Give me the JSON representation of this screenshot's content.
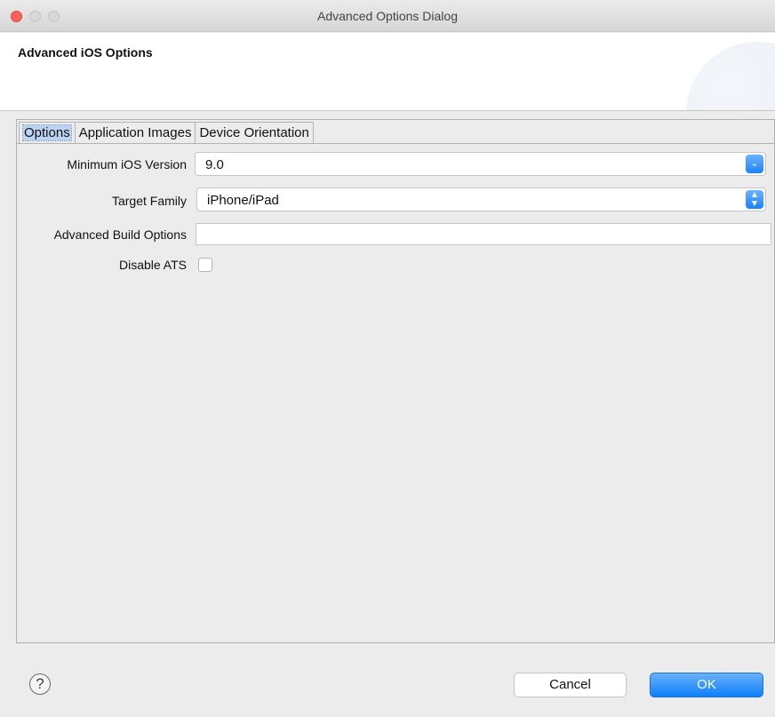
{
  "window": {
    "title": "Advanced Options Dialog"
  },
  "header": {
    "title": "Advanced iOS Options"
  },
  "tabs": [
    {
      "label": "Options",
      "active": true
    },
    {
      "label": "Application Images",
      "active": false
    },
    {
      "label": "Device Orientation",
      "active": false
    }
  ],
  "options": {
    "min_ios_version": {
      "label": "Minimum iOS Version",
      "value": "9.0",
      "control_icon": "chevron-down-icon"
    },
    "target_family": {
      "label": "Target Family",
      "value": "iPhone/iPad",
      "control_icon": "up-down-chevron-icon"
    },
    "advanced_build_options": {
      "label": "Advanced Build Options",
      "value": ""
    },
    "disable_ats": {
      "label": "Disable ATS",
      "checked": false
    }
  },
  "footer": {
    "help_icon": "help-icon",
    "help_glyph": "?",
    "cancel_label": "Cancel",
    "ok_label": "OK"
  },
  "colors": {
    "accent": "#1a82fb",
    "close": "#fc605b",
    "tab_highlight": "#bcd2f2"
  }
}
